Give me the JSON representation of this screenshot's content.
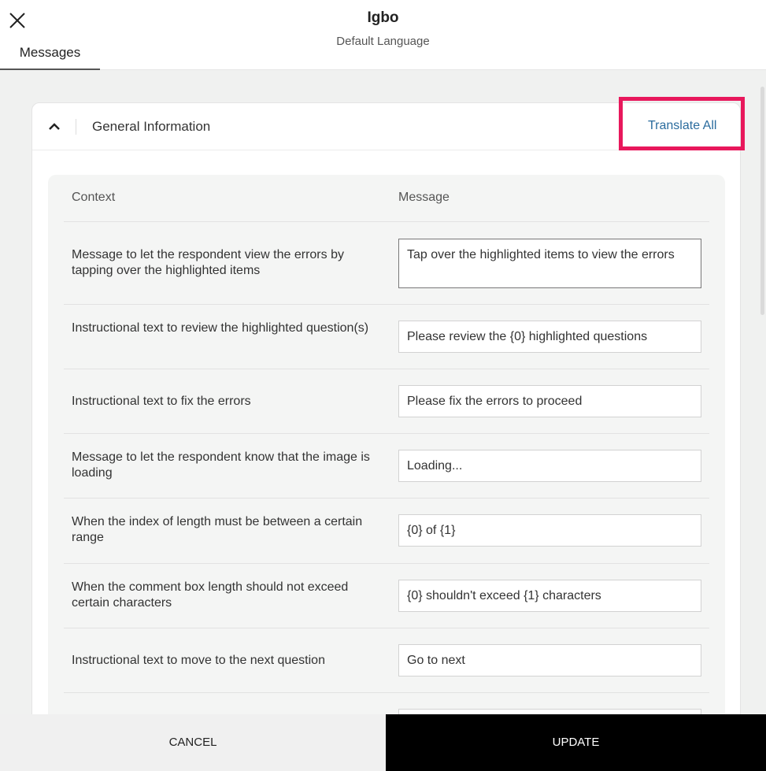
{
  "header": {
    "title": "Igbo",
    "subtitle": "Default Language",
    "tab_label": "Messages"
  },
  "section": {
    "title": "General Information",
    "translate_all_label": "Translate All"
  },
  "table": {
    "columns": [
      "Context",
      "Message"
    ],
    "rows": [
      {
        "context": "Message to let the respondent view the errors by tapping over the highlighted items",
        "message": "Tap over the highlighted items to view the errors"
      },
      {
        "context": "Instructional text to review the highlighted question(s)",
        "message": "Please review the {0} highlighted questions"
      },
      {
        "context": "Instructional text to fix the errors",
        "message": "Please fix the errors to proceed"
      },
      {
        "context": "Message to let the respondent know that the image is loading",
        "message": "Loading..."
      },
      {
        "context": "When the index of length must be between a certain range",
        "message": "{0} of {1}"
      },
      {
        "context": "When the comment box length should not exceed certain characters",
        "message": "{0} shouldn't exceed {1} characters"
      },
      {
        "context": "Instructional text to move to the next question",
        "message": "Go to next"
      },
      {
        "context": "",
        "message": ""
      }
    ]
  },
  "footer": {
    "cancel_label": "CANCEL",
    "update_label": "UPDATE"
  },
  "colors": {
    "highlight": "#e8185c",
    "link": "#2b6c9e"
  }
}
